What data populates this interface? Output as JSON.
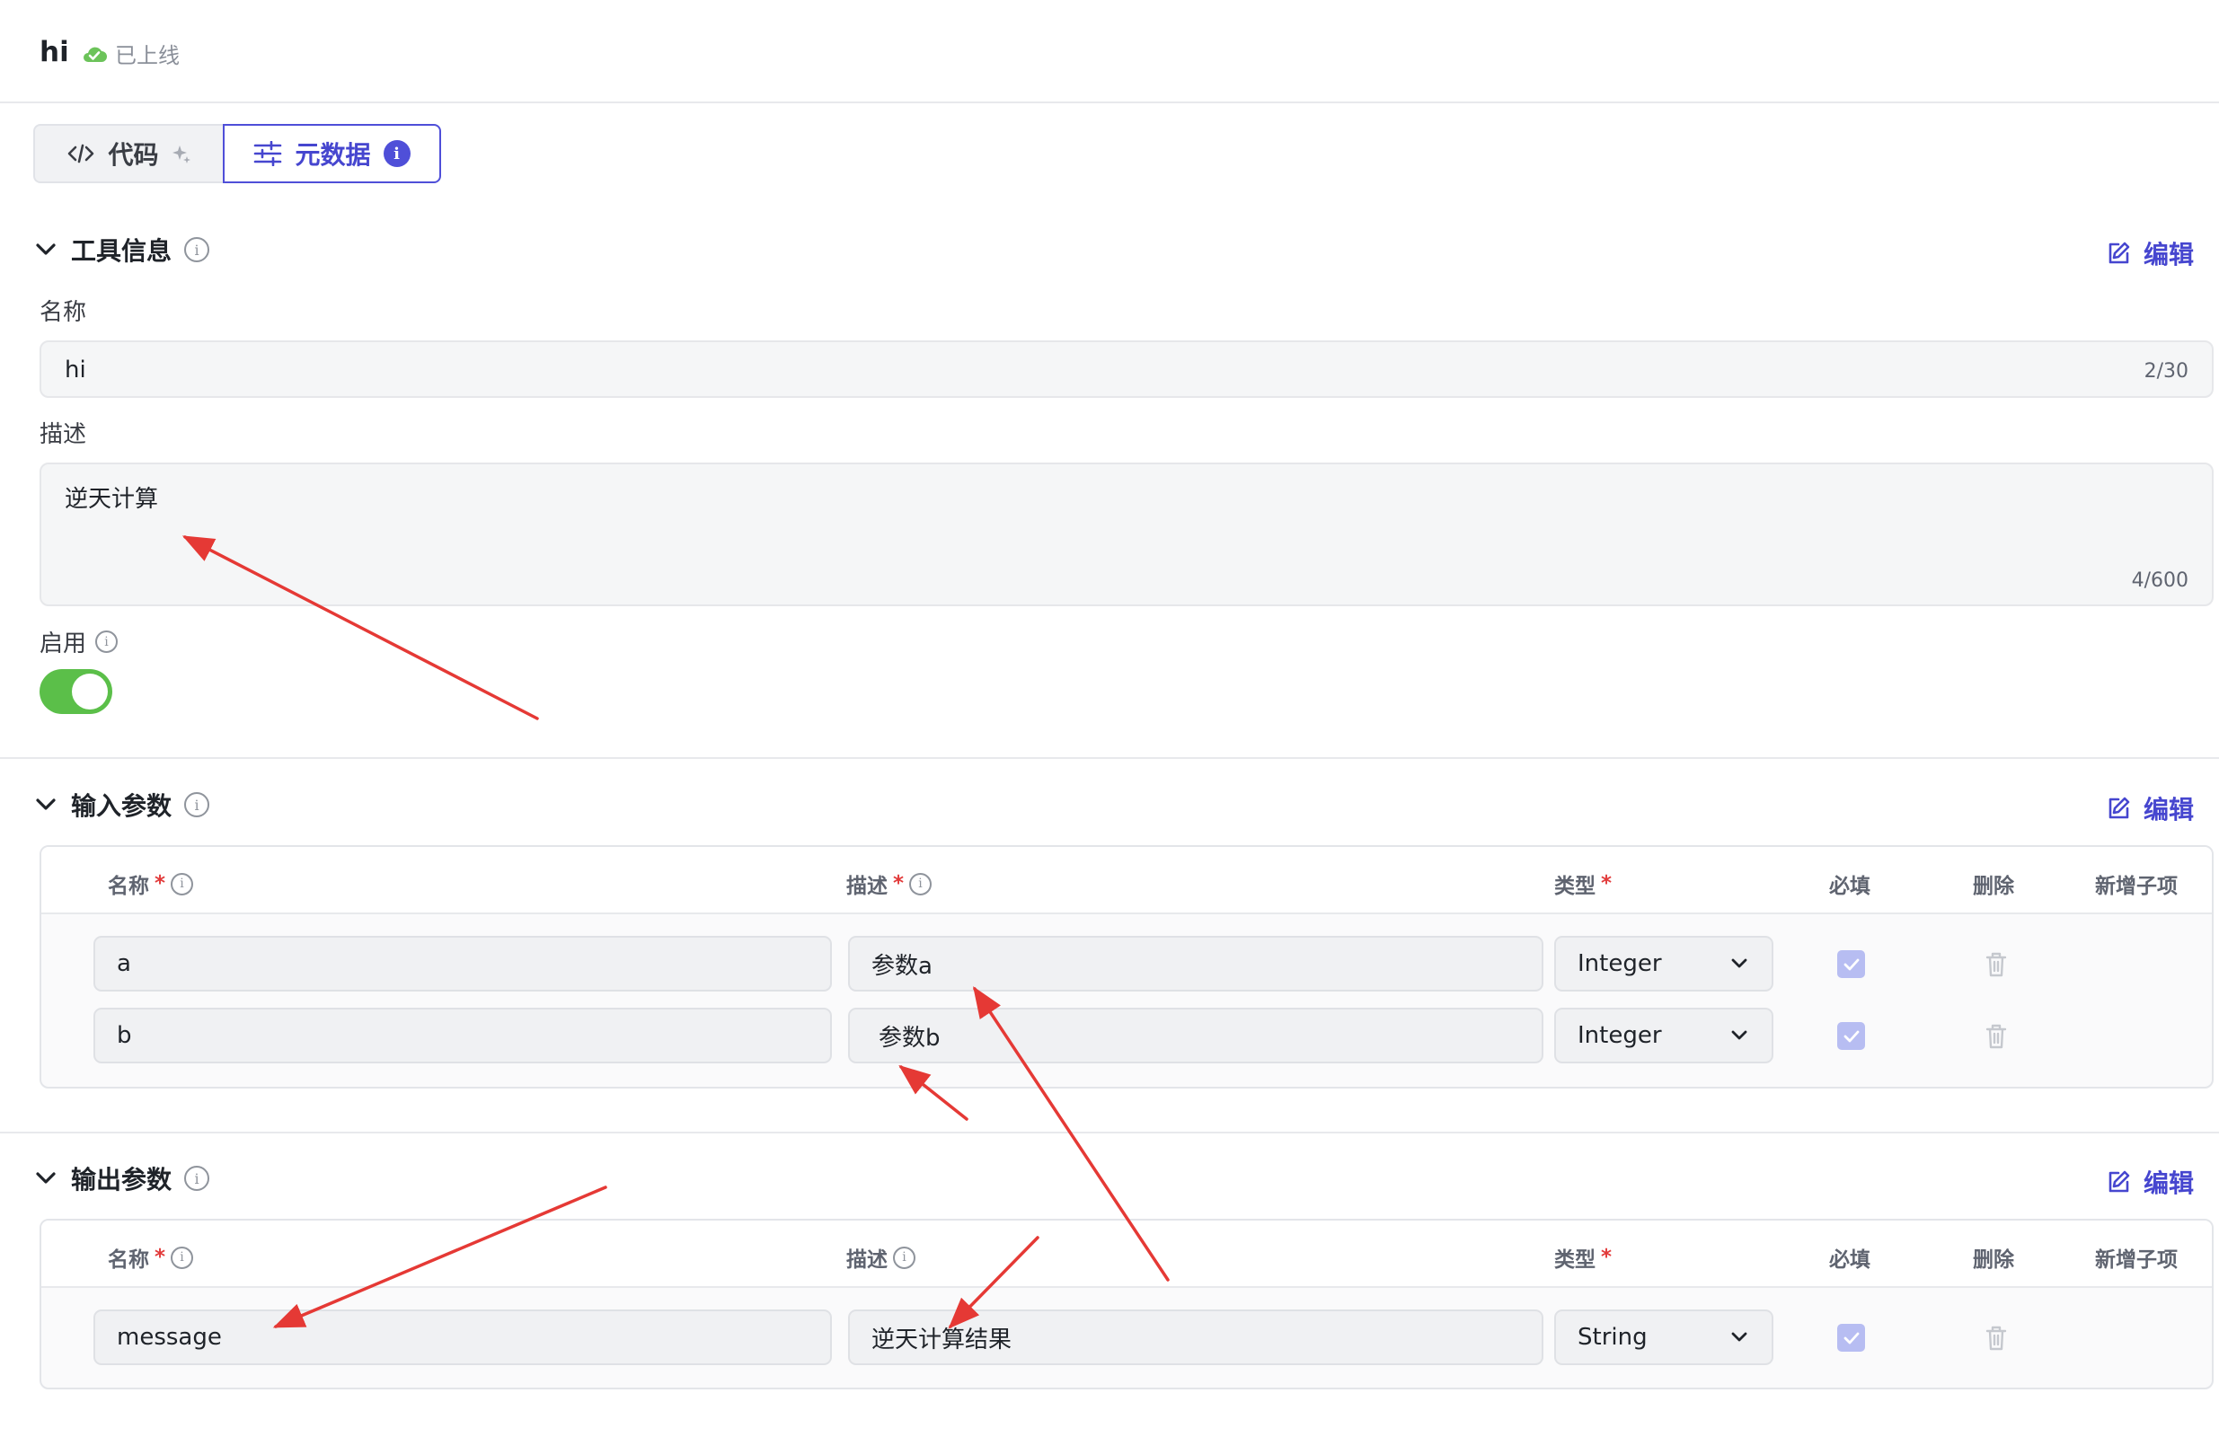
{
  "header": {
    "title": "hi",
    "status": "已上线"
  },
  "tabs": [
    {
      "label": "代码",
      "icon": "code-icon",
      "active": false
    },
    {
      "label": "元数据",
      "icon": "sliders-icon",
      "active": true,
      "badge": "i"
    }
  ],
  "tool_info": {
    "title": "工具信息",
    "edit_label": "编辑",
    "name_label": "名称",
    "name_value": "hi",
    "name_counter": "2/30",
    "desc_label": "描述",
    "desc_value": "逆天计算",
    "desc_counter": "4/600",
    "enable_label": "启用",
    "enabled": true
  },
  "input_params": {
    "title": "输入参数",
    "edit_label": "编辑",
    "columns": {
      "name": "名称",
      "desc": "描述",
      "type": "类型",
      "required": "必填",
      "delete": "删除",
      "add_child": "新增子项"
    },
    "rows": [
      {
        "name": "a",
        "desc": "参数a",
        "type": "Integer",
        "required": true
      },
      {
        "name": "b",
        "desc": "参数b",
        "type": "Integer",
        "required": true
      }
    ]
  },
  "output_params": {
    "title": "输出参数",
    "edit_label": "编辑",
    "columns": {
      "name": "名称",
      "desc": "描述",
      "type": "类型",
      "required": "必填",
      "delete": "删除",
      "add_child": "新增子项"
    },
    "rows": [
      {
        "name": "message",
        "desc": "逆天计算结果",
        "type": "String",
        "required": true
      }
    ]
  },
  "colors": {
    "accent": "#4f4fd8",
    "toggle_on": "#5bbf49",
    "required_star": "#e23b3b",
    "annotation_arrow": "#e53935"
  }
}
